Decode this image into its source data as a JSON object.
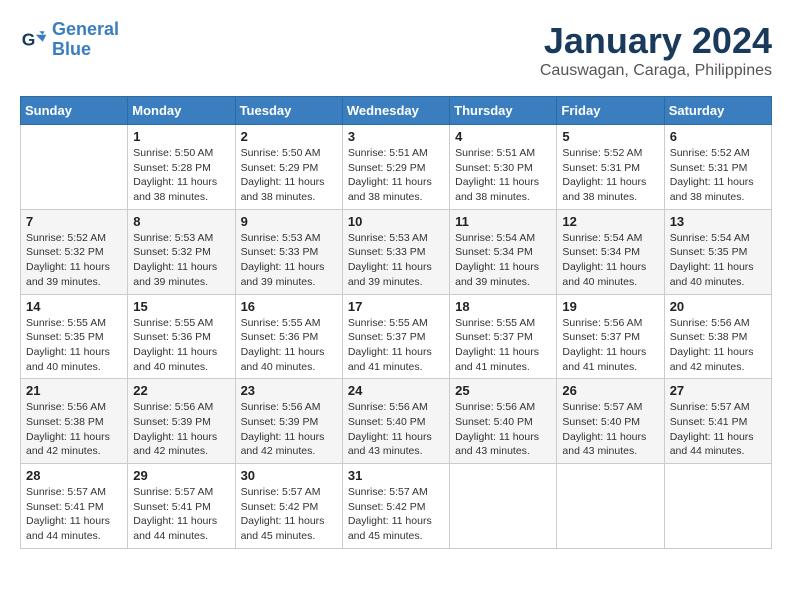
{
  "header": {
    "logo_line1": "General",
    "logo_line2": "Blue",
    "month": "January 2024",
    "location": "Causwagan, Caraga, Philippines"
  },
  "days_of_week": [
    "Sunday",
    "Monday",
    "Tuesday",
    "Wednesday",
    "Thursday",
    "Friday",
    "Saturday"
  ],
  "weeks": [
    [
      {
        "day": "",
        "info": ""
      },
      {
        "day": "1",
        "info": "Sunrise: 5:50 AM\nSunset: 5:28 PM\nDaylight: 11 hours\nand 38 minutes."
      },
      {
        "day": "2",
        "info": "Sunrise: 5:50 AM\nSunset: 5:29 PM\nDaylight: 11 hours\nand 38 minutes."
      },
      {
        "day": "3",
        "info": "Sunrise: 5:51 AM\nSunset: 5:29 PM\nDaylight: 11 hours\nand 38 minutes."
      },
      {
        "day": "4",
        "info": "Sunrise: 5:51 AM\nSunset: 5:30 PM\nDaylight: 11 hours\nand 38 minutes."
      },
      {
        "day": "5",
        "info": "Sunrise: 5:52 AM\nSunset: 5:31 PM\nDaylight: 11 hours\nand 38 minutes."
      },
      {
        "day": "6",
        "info": "Sunrise: 5:52 AM\nSunset: 5:31 PM\nDaylight: 11 hours\nand 38 minutes."
      }
    ],
    [
      {
        "day": "7",
        "info": "Sunrise: 5:52 AM\nSunset: 5:32 PM\nDaylight: 11 hours\nand 39 minutes."
      },
      {
        "day": "8",
        "info": "Sunrise: 5:53 AM\nSunset: 5:32 PM\nDaylight: 11 hours\nand 39 minutes."
      },
      {
        "day": "9",
        "info": "Sunrise: 5:53 AM\nSunset: 5:33 PM\nDaylight: 11 hours\nand 39 minutes."
      },
      {
        "day": "10",
        "info": "Sunrise: 5:53 AM\nSunset: 5:33 PM\nDaylight: 11 hours\nand 39 minutes."
      },
      {
        "day": "11",
        "info": "Sunrise: 5:54 AM\nSunset: 5:34 PM\nDaylight: 11 hours\nand 39 minutes."
      },
      {
        "day": "12",
        "info": "Sunrise: 5:54 AM\nSunset: 5:34 PM\nDaylight: 11 hours\nand 40 minutes."
      },
      {
        "day": "13",
        "info": "Sunrise: 5:54 AM\nSunset: 5:35 PM\nDaylight: 11 hours\nand 40 minutes."
      }
    ],
    [
      {
        "day": "14",
        "info": "Sunrise: 5:55 AM\nSunset: 5:35 PM\nDaylight: 11 hours\nand 40 minutes."
      },
      {
        "day": "15",
        "info": "Sunrise: 5:55 AM\nSunset: 5:36 PM\nDaylight: 11 hours\nand 40 minutes."
      },
      {
        "day": "16",
        "info": "Sunrise: 5:55 AM\nSunset: 5:36 PM\nDaylight: 11 hours\nand 40 minutes."
      },
      {
        "day": "17",
        "info": "Sunrise: 5:55 AM\nSunset: 5:37 PM\nDaylight: 11 hours\nand 41 minutes."
      },
      {
        "day": "18",
        "info": "Sunrise: 5:55 AM\nSunset: 5:37 PM\nDaylight: 11 hours\nand 41 minutes."
      },
      {
        "day": "19",
        "info": "Sunrise: 5:56 AM\nSunset: 5:37 PM\nDaylight: 11 hours\nand 41 minutes."
      },
      {
        "day": "20",
        "info": "Sunrise: 5:56 AM\nSunset: 5:38 PM\nDaylight: 11 hours\nand 42 minutes."
      }
    ],
    [
      {
        "day": "21",
        "info": "Sunrise: 5:56 AM\nSunset: 5:38 PM\nDaylight: 11 hours\nand 42 minutes."
      },
      {
        "day": "22",
        "info": "Sunrise: 5:56 AM\nSunset: 5:39 PM\nDaylight: 11 hours\nand 42 minutes."
      },
      {
        "day": "23",
        "info": "Sunrise: 5:56 AM\nSunset: 5:39 PM\nDaylight: 11 hours\nand 42 minutes."
      },
      {
        "day": "24",
        "info": "Sunrise: 5:56 AM\nSunset: 5:40 PM\nDaylight: 11 hours\nand 43 minutes."
      },
      {
        "day": "25",
        "info": "Sunrise: 5:56 AM\nSunset: 5:40 PM\nDaylight: 11 hours\nand 43 minutes."
      },
      {
        "day": "26",
        "info": "Sunrise: 5:57 AM\nSunset: 5:40 PM\nDaylight: 11 hours\nand 43 minutes."
      },
      {
        "day": "27",
        "info": "Sunrise: 5:57 AM\nSunset: 5:41 PM\nDaylight: 11 hours\nand 44 minutes."
      }
    ],
    [
      {
        "day": "28",
        "info": "Sunrise: 5:57 AM\nSunset: 5:41 PM\nDaylight: 11 hours\nand 44 minutes."
      },
      {
        "day": "29",
        "info": "Sunrise: 5:57 AM\nSunset: 5:41 PM\nDaylight: 11 hours\nand 44 minutes."
      },
      {
        "day": "30",
        "info": "Sunrise: 5:57 AM\nSunset: 5:42 PM\nDaylight: 11 hours\nand 45 minutes."
      },
      {
        "day": "31",
        "info": "Sunrise: 5:57 AM\nSunset: 5:42 PM\nDaylight: 11 hours\nand 45 minutes."
      },
      {
        "day": "",
        "info": ""
      },
      {
        "day": "",
        "info": ""
      },
      {
        "day": "",
        "info": ""
      }
    ]
  ]
}
